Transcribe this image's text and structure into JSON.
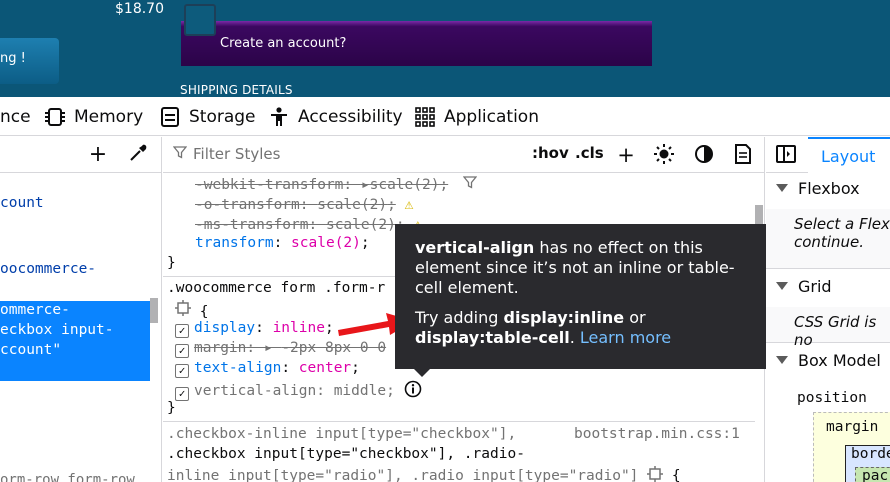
{
  "site": {
    "price": "$18.70",
    "side_button": "ng !",
    "create_account": "Create an account?",
    "shipping": "SHIPPING DETAILS"
  },
  "tabs": [
    {
      "label": "nce",
      "icon": "none"
    },
    {
      "label": "Memory",
      "icon": "memory-chip-icon"
    },
    {
      "label": "Storage",
      "icon": "storage-icon"
    },
    {
      "label": "Accessibility",
      "icon": "accessibility-icon"
    },
    {
      "label": "Application",
      "icon": "grid-icon"
    }
  ],
  "tree": {
    "lines": [
      "count",
      "oocommerce-"
    ],
    "selected": [
      "ommerce-",
      "eckbox input-",
      "ccount\""
    ],
    "bottom": "orm-row form-row"
  },
  "rules": {
    "filter_placeholder": "Filter Styles",
    "hov": ":hov",
    "cls": ".cls",
    "overridden": [
      {
        "name": "-webkit-transform",
        "value": "scale(2)"
      },
      {
        "name": "-o-transform",
        "value": "scale(2)"
      },
      {
        "name": "-ms-transform",
        "value": "scale(2)"
      }
    ],
    "transform_name": "transform",
    "transform_value": "scale(2)",
    "selector2": ".woocommerce form .form-r",
    "decls": [
      {
        "name": "display",
        "value": "inline"
      },
      {
        "name": "margin",
        "value": "-2px 8px 0 0"
      },
      {
        "name": "text-align",
        "value": "center"
      },
      {
        "name": "vertical-align",
        "value": "middle"
      }
    ],
    "selector3a": ".checkbox-inline input[type=\"checkbox\"],",
    "source3": "bootstrap.min.css:1",
    "selector3b": ".checkbox input[type=\"checkbox\"], .radio-",
    "selector3c": "inline input[type=\"radio\"], .radio input[type=\"radio\"]"
  },
  "tooltip": {
    "prop": "vertical-align",
    "text1": " has no effect on this element since it’s not an inline or table-cell element.",
    "try": "Try adding ",
    "opt1": "display:inline",
    "or": " or ",
    "opt2": "display:table-cell",
    "dot": ". ",
    "learn_more": "Learn more"
  },
  "layout": {
    "tab": "Layout",
    "flexbox": "Flexbox",
    "flex_hint": "Select a Flex continue.",
    "grid": "Grid",
    "grid_hint": "CSS Grid is no",
    "boxmodel": "Box Model",
    "position": "position",
    "margin": "margin",
    "border": "borde",
    "padding": "pac"
  },
  "colors": {
    "accent": "#0a84ff",
    "prop_name": "#0074e8",
    "prop_value": "#dd00a9",
    "tooltip_bg": "#2a2a2e",
    "warning": "#d7b600",
    "site_bg": "#0b5677"
  }
}
